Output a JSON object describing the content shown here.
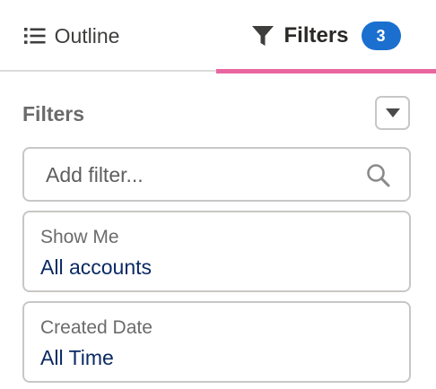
{
  "tabs": {
    "outline": {
      "label": "Outline",
      "icon": "list-icon"
    },
    "filters": {
      "label": "Filters",
      "icon": "funnel-icon",
      "badge": "3",
      "active": true
    }
  },
  "filters_panel": {
    "title": "Filters",
    "dropdown_icon": "caret-down-icon",
    "search": {
      "placeholder": "Add filter...",
      "value": "",
      "icon": "search-icon"
    },
    "items": [
      {
        "label": "Show Me",
        "value": "All accounts"
      },
      {
        "label": "Created Date",
        "value": "All Time"
      }
    ]
  },
  "colors": {
    "accent_underline": "#e8659f",
    "badge_bg": "#1b6fcf",
    "value_text": "#0b2a63",
    "border": "#c9c7c5"
  }
}
